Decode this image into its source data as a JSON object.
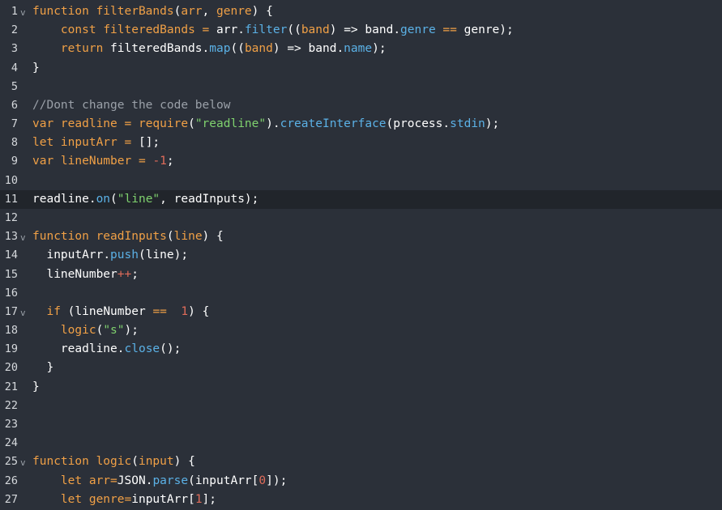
{
  "editor": {
    "fold_glyph": "v",
    "active_line": 11,
    "colors": {
      "background": "#2b3039",
      "active_line": "#21252b",
      "keyword": "#f0a046",
      "property": "#5bb1e6",
      "string": "#7fd16e",
      "number": "#e06c5a",
      "comment": "#9aa0a8",
      "text": "#ffffff"
    },
    "lines": [
      {
        "n": "1",
        "fold": true,
        "tokens": [
          {
            "t": "function ",
            "c": "k"
          },
          {
            "t": "filterBands",
            "c": "k"
          },
          {
            "t": "(",
            "c": "t"
          },
          {
            "t": "arr",
            "c": "k"
          },
          {
            "t": ", ",
            "c": "t"
          },
          {
            "t": "genre",
            "c": "k"
          },
          {
            "t": ") {",
            "c": "t"
          }
        ]
      },
      {
        "n": "2",
        "fold": false,
        "tokens": [
          {
            "t": "    ",
            "c": "t"
          },
          {
            "t": "const ",
            "c": "k"
          },
          {
            "t": "filteredBands",
            "c": "k"
          },
          {
            "t": " = ",
            "c": "k"
          },
          {
            "t": "arr",
            "c": "t"
          },
          {
            "t": ".",
            "c": "t"
          },
          {
            "t": "filter",
            "c": "p"
          },
          {
            "t": "((",
            "c": "t"
          },
          {
            "t": "band",
            "c": "k"
          },
          {
            "t": ") => ",
            "c": "t"
          },
          {
            "t": "band",
            "c": "t"
          },
          {
            "t": ".",
            "c": "t"
          },
          {
            "t": "genre",
            "c": "p"
          },
          {
            "t": " == ",
            "c": "k"
          },
          {
            "t": "genre",
            "c": "t"
          },
          {
            "t": ");",
            "c": "t"
          }
        ]
      },
      {
        "n": "3",
        "fold": false,
        "tokens": [
          {
            "t": "    ",
            "c": "t"
          },
          {
            "t": "return ",
            "c": "k"
          },
          {
            "t": "filteredBands",
            "c": "t"
          },
          {
            "t": ".",
            "c": "t"
          },
          {
            "t": "map",
            "c": "p"
          },
          {
            "t": "((",
            "c": "t"
          },
          {
            "t": "band",
            "c": "k"
          },
          {
            "t": ") => ",
            "c": "t"
          },
          {
            "t": "band",
            "c": "t"
          },
          {
            "t": ".",
            "c": "t"
          },
          {
            "t": "name",
            "c": "p"
          },
          {
            "t": ");",
            "c": "t"
          }
        ]
      },
      {
        "n": "4",
        "fold": false,
        "tokens": [
          {
            "t": "}",
            "c": "t"
          }
        ]
      },
      {
        "n": "5",
        "fold": false,
        "tokens": []
      },
      {
        "n": "6",
        "fold": false,
        "tokens": [
          {
            "t": "//Dont change the code below",
            "c": "c"
          }
        ]
      },
      {
        "n": "7",
        "fold": false,
        "tokens": [
          {
            "t": "var ",
            "c": "k"
          },
          {
            "t": "readline",
            "c": "k"
          },
          {
            "t": " = ",
            "c": "k"
          },
          {
            "t": "require",
            "c": "k"
          },
          {
            "t": "(",
            "c": "t"
          },
          {
            "t": "\"readline\"",
            "c": "s"
          },
          {
            "t": ").",
            "c": "t"
          },
          {
            "t": "createInterface",
            "c": "p"
          },
          {
            "t": "(",
            "c": "t"
          },
          {
            "t": "process",
            "c": "t"
          },
          {
            "t": ".",
            "c": "t"
          },
          {
            "t": "stdin",
            "c": "p"
          },
          {
            "t": ");",
            "c": "t"
          }
        ]
      },
      {
        "n": "8",
        "fold": false,
        "tokens": [
          {
            "t": "let ",
            "c": "k"
          },
          {
            "t": "inputArr",
            "c": "k"
          },
          {
            "t": " = ",
            "c": "k"
          },
          {
            "t": "[];",
            "c": "t"
          }
        ]
      },
      {
        "n": "9",
        "fold": false,
        "tokens": [
          {
            "t": "var ",
            "c": "k"
          },
          {
            "t": "lineNumber",
            "c": "k"
          },
          {
            "t": " = ",
            "c": "k"
          },
          {
            "t": "-1",
            "c": "n"
          },
          {
            "t": ";",
            "c": "t"
          }
        ]
      },
      {
        "n": "10",
        "fold": false,
        "tokens": []
      },
      {
        "n": "11",
        "fold": false,
        "tokens": [
          {
            "t": "readline",
            "c": "t"
          },
          {
            "t": ".",
            "c": "t"
          },
          {
            "t": "on",
            "c": "p"
          },
          {
            "t": "(",
            "c": "t"
          },
          {
            "t": "\"line\"",
            "c": "s"
          },
          {
            "t": ", readInputs);",
            "c": "t"
          }
        ]
      },
      {
        "n": "12",
        "fold": false,
        "tokens": []
      },
      {
        "n": "13",
        "fold": true,
        "tokens": [
          {
            "t": "function ",
            "c": "k"
          },
          {
            "t": "readInputs",
            "c": "k"
          },
          {
            "t": "(",
            "c": "t"
          },
          {
            "t": "line",
            "c": "k"
          },
          {
            "t": ") {",
            "c": "t"
          }
        ]
      },
      {
        "n": "14",
        "fold": false,
        "tokens": [
          {
            "t": "  inputArr",
            "c": "t"
          },
          {
            "t": ".",
            "c": "t"
          },
          {
            "t": "push",
            "c": "p"
          },
          {
            "t": "(line);",
            "c": "t"
          }
        ]
      },
      {
        "n": "15",
        "fold": false,
        "tokens": [
          {
            "t": "  lineNumber",
            "c": "t"
          },
          {
            "t": "++",
            "c": "n"
          },
          {
            "t": ";",
            "c": "t"
          }
        ]
      },
      {
        "n": "16",
        "fold": false,
        "tokens": []
      },
      {
        "n": "17",
        "fold": true,
        "tokens": [
          {
            "t": "  ",
            "c": "t"
          },
          {
            "t": "if ",
            "c": "k"
          },
          {
            "t": "(lineNumber ",
            "c": "t"
          },
          {
            "t": "==",
            "c": "k"
          },
          {
            "t": "  ",
            "c": "t"
          },
          {
            "t": "1",
            "c": "n"
          },
          {
            "t": ") {",
            "c": "t"
          }
        ]
      },
      {
        "n": "18",
        "fold": false,
        "tokens": [
          {
            "t": "    ",
            "c": "t"
          },
          {
            "t": "logic",
            "c": "k"
          },
          {
            "t": "(",
            "c": "t"
          },
          {
            "t": "\"s\"",
            "c": "s"
          },
          {
            "t": ");",
            "c": "t"
          }
        ]
      },
      {
        "n": "19",
        "fold": false,
        "tokens": [
          {
            "t": "    readline",
            "c": "t"
          },
          {
            "t": ".",
            "c": "t"
          },
          {
            "t": "close",
            "c": "p"
          },
          {
            "t": "();",
            "c": "t"
          }
        ]
      },
      {
        "n": "20",
        "fold": false,
        "tokens": [
          {
            "t": "  }",
            "c": "t"
          }
        ]
      },
      {
        "n": "21",
        "fold": false,
        "tokens": [
          {
            "t": "}",
            "c": "t"
          }
        ]
      },
      {
        "n": "22",
        "fold": false,
        "tokens": []
      },
      {
        "n": "23",
        "fold": false,
        "tokens": []
      },
      {
        "n": "24",
        "fold": false,
        "tokens": []
      },
      {
        "n": "25",
        "fold": true,
        "tokens": [
          {
            "t": "function ",
            "c": "k"
          },
          {
            "t": "logic",
            "c": "k"
          },
          {
            "t": "(",
            "c": "t"
          },
          {
            "t": "input",
            "c": "k"
          },
          {
            "t": ") {",
            "c": "t"
          }
        ]
      },
      {
        "n": "26",
        "fold": false,
        "tokens": [
          {
            "t": "    ",
            "c": "t"
          },
          {
            "t": "let ",
            "c": "k"
          },
          {
            "t": "arr",
            "c": "k"
          },
          {
            "t": "=",
            "c": "k"
          },
          {
            "t": "JSON",
            "c": "t"
          },
          {
            "t": ".",
            "c": "t"
          },
          {
            "t": "parse",
            "c": "p"
          },
          {
            "t": "(inputArr[",
            "c": "t"
          },
          {
            "t": "0",
            "c": "n"
          },
          {
            "t": "]);",
            "c": "t"
          }
        ]
      },
      {
        "n": "27",
        "fold": false,
        "tokens": [
          {
            "t": "    ",
            "c": "t"
          },
          {
            "t": "let ",
            "c": "k"
          },
          {
            "t": "genre",
            "c": "k"
          },
          {
            "t": "=",
            "c": "k"
          },
          {
            "t": "inputArr[",
            "c": "t"
          },
          {
            "t": "1",
            "c": "n"
          },
          {
            "t": "];",
            "c": "t"
          }
        ]
      }
    ]
  }
}
